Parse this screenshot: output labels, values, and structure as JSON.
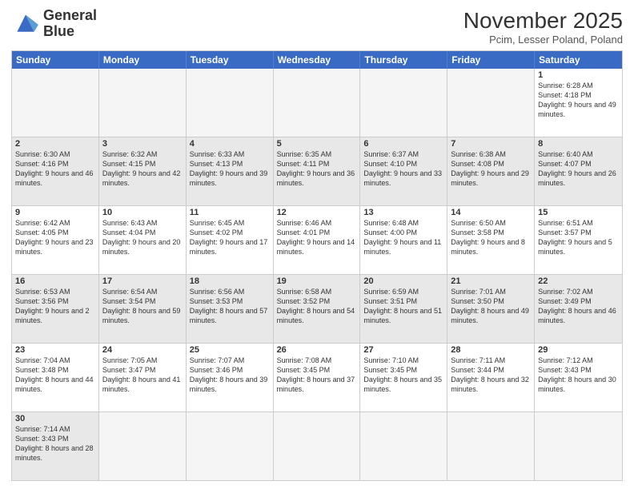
{
  "logo": {
    "line1": "General",
    "line2": "Blue"
  },
  "title": "November 2025",
  "subtitle": "Pcim, Lesser Poland, Poland",
  "header_days": [
    "Sunday",
    "Monday",
    "Tuesday",
    "Wednesday",
    "Thursday",
    "Friday",
    "Saturday"
  ],
  "rows": [
    {
      "alt": false,
      "cells": [
        {
          "day": "",
          "info": "",
          "empty": true
        },
        {
          "day": "",
          "info": "",
          "empty": true
        },
        {
          "day": "",
          "info": "",
          "empty": true
        },
        {
          "day": "",
          "info": "",
          "empty": true
        },
        {
          "day": "",
          "info": "",
          "empty": true
        },
        {
          "day": "",
          "info": "",
          "empty": true
        },
        {
          "day": "1",
          "info": "Sunrise: 6:28 AM\nSunset: 4:18 PM\nDaylight: 9 hours\nand 49 minutes.",
          "empty": false
        }
      ]
    },
    {
      "alt": true,
      "cells": [
        {
          "day": "2",
          "info": "Sunrise: 6:30 AM\nSunset: 4:16 PM\nDaylight: 9 hours\nand 46 minutes.",
          "empty": false
        },
        {
          "day": "3",
          "info": "Sunrise: 6:32 AM\nSunset: 4:15 PM\nDaylight: 9 hours\nand 42 minutes.",
          "empty": false
        },
        {
          "day": "4",
          "info": "Sunrise: 6:33 AM\nSunset: 4:13 PM\nDaylight: 9 hours\nand 39 minutes.",
          "empty": false
        },
        {
          "day": "5",
          "info": "Sunrise: 6:35 AM\nSunset: 4:11 PM\nDaylight: 9 hours\nand 36 minutes.",
          "empty": false
        },
        {
          "day": "6",
          "info": "Sunrise: 6:37 AM\nSunset: 4:10 PM\nDaylight: 9 hours\nand 33 minutes.",
          "empty": false
        },
        {
          "day": "7",
          "info": "Sunrise: 6:38 AM\nSunset: 4:08 PM\nDaylight: 9 hours\nand 29 minutes.",
          "empty": false
        },
        {
          "day": "8",
          "info": "Sunrise: 6:40 AM\nSunset: 4:07 PM\nDaylight: 9 hours\nand 26 minutes.",
          "empty": false
        }
      ]
    },
    {
      "alt": false,
      "cells": [
        {
          "day": "9",
          "info": "Sunrise: 6:42 AM\nSunset: 4:05 PM\nDaylight: 9 hours\nand 23 minutes.",
          "empty": false
        },
        {
          "day": "10",
          "info": "Sunrise: 6:43 AM\nSunset: 4:04 PM\nDaylight: 9 hours\nand 20 minutes.",
          "empty": false
        },
        {
          "day": "11",
          "info": "Sunrise: 6:45 AM\nSunset: 4:02 PM\nDaylight: 9 hours\nand 17 minutes.",
          "empty": false
        },
        {
          "day": "12",
          "info": "Sunrise: 6:46 AM\nSunset: 4:01 PM\nDaylight: 9 hours\nand 14 minutes.",
          "empty": false
        },
        {
          "day": "13",
          "info": "Sunrise: 6:48 AM\nSunset: 4:00 PM\nDaylight: 9 hours\nand 11 minutes.",
          "empty": false
        },
        {
          "day": "14",
          "info": "Sunrise: 6:50 AM\nSunset: 3:58 PM\nDaylight: 9 hours\nand 8 minutes.",
          "empty": false
        },
        {
          "day": "15",
          "info": "Sunrise: 6:51 AM\nSunset: 3:57 PM\nDaylight: 9 hours\nand 5 minutes.",
          "empty": false
        }
      ]
    },
    {
      "alt": true,
      "cells": [
        {
          "day": "16",
          "info": "Sunrise: 6:53 AM\nSunset: 3:56 PM\nDaylight: 9 hours\nand 2 minutes.",
          "empty": false
        },
        {
          "day": "17",
          "info": "Sunrise: 6:54 AM\nSunset: 3:54 PM\nDaylight: 8 hours\nand 59 minutes.",
          "empty": false
        },
        {
          "day": "18",
          "info": "Sunrise: 6:56 AM\nSunset: 3:53 PM\nDaylight: 8 hours\nand 57 minutes.",
          "empty": false
        },
        {
          "day": "19",
          "info": "Sunrise: 6:58 AM\nSunset: 3:52 PM\nDaylight: 8 hours\nand 54 minutes.",
          "empty": false
        },
        {
          "day": "20",
          "info": "Sunrise: 6:59 AM\nSunset: 3:51 PM\nDaylight: 8 hours\nand 51 minutes.",
          "empty": false
        },
        {
          "day": "21",
          "info": "Sunrise: 7:01 AM\nSunset: 3:50 PM\nDaylight: 8 hours\nand 49 minutes.",
          "empty": false
        },
        {
          "day": "22",
          "info": "Sunrise: 7:02 AM\nSunset: 3:49 PM\nDaylight: 8 hours\nand 46 minutes.",
          "empty": false
        }
      ]
    },
    {
      "alt": false,
      "cells": [
        {
          "day": "23",
          "info": "Sunrise: 7:04 AM\nSunset: 3:48 PM\nDaylight: 8 hours\nand 44 minutes.",
          "empty": false
        },
        {
          "day": "24",
          "info": "Sunrise: 7:05 AM\nSunset: 3:47 PM\nDaylight: 8 hours\nand 41 minutes.",
          "empty": false
        },
        {
          "day": "25",
          "info": "Sunrise: 7:07 AM\nSunset: 3:46 PM\nDaylight: 8 hours\nand 39 minutes.",
          "empty": false
        },
        {
          "day": "26",
          "info": "Sunrise: 7:08 AM\nSunset: 3:45 PM\nDaylight: 8 hours\nand 37 minutes.",
          "empty": false
        },
        {
          "day": "27",
          "info": "Sunrise: 7:10 AM\nSunset: 3:45 PM\nDaylight: 8 hours\nand 35 minutes.",
          "empty": false
        },
        {
          "day": "28",
          "info": "Sunrise: 7:11 AM\nSunset: 3:44 PM\nDaylight: 8 hours\nand 32 minutes.",
          "empty": false
        },
        {
          "day": "29",
          "info": "Sunrise: 7:12 AM\nSunset: 3:43 PM\nDaylight: 8 hours\nand 30 minutes.",
          "empty": false
        }
      ]
    },
    {
      "alt": true,
      "cells": [
        {
          "day": "30",
          "info": "Sunrise: 7:14 AM\nSunset: 3:43 PM\nDaylight: 8 hours\nand 28 minutes.",
          "empty": false
        },
        {
          "day": "",
          "info": "",
          "empty": true
        },
        {
          "day": "",
          "info": "",
          "empty": true
        },
        {
          "day": "",
          "info": "",
          "empty": true
        },
        {
          "day": "",
          "info": "",
          "empty": true
        },
        {
          "day": "",
          "info": "",
          "empty": true
        },
        {
          "day": "",
          "info": "",
          "empty": true
        }
      ]
    }
  ]
}
